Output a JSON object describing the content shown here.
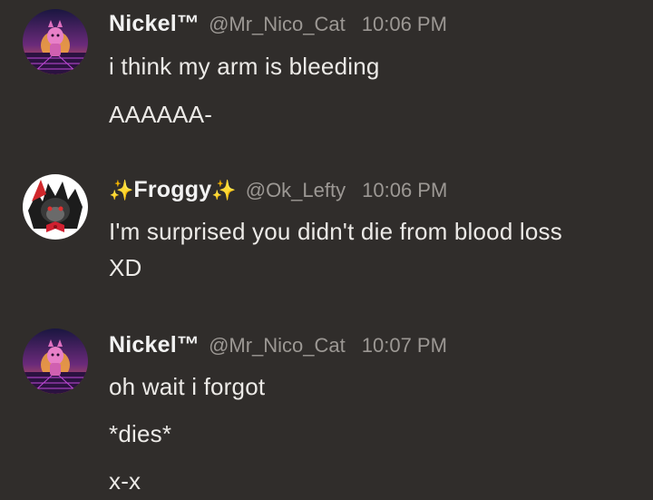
{
  "messages": [
    {
      "username": "Nickel™",
      "handle": "@Mr_Nico_Cat",
      "time": "10:06 PM",
      "lines": [
        "i think my arm is bleeding",
        "AAAAAA-"
      ]
    },
    {
      "username": "Froggy",
      "sparkle_left": "✨",
      "sparkle_right": "✨",
      "handle": "@Ok_Lefty",
      "time": "10:06 PM",
      "lines": [
        "I'm surprised you didn't die from blood loss",
        "XD"
      ]
    },
    {
      "username": "Nickel™",
      "handle": "@Mr_Nico_Cat",
      "time": "10:07 PM",
      "lines": [
        "oh wait i forgot",
        "*dies*",
        "x-x"
      ]
    }
  ],
  "colors": {
    "background": "#302d2b",
    "text": "#eceae7",
    "muted": "#9c9894",
    "sparkle": "#f7c948"
  }
}
